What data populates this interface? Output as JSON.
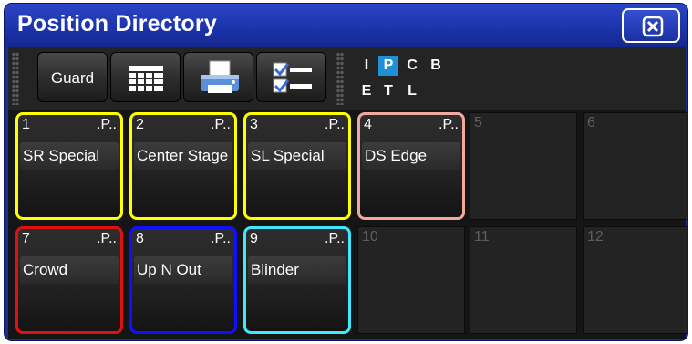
{
  "window": {
    "title": "Position Directory"
  },
  "toolbar": {
    "guard_label": "Guard",
    "buttons": [
      {
        "label": "Guard",
        "icon": "guard"
      },
      {
        "icon": "grid-view-icon"
      },
      {
        "icon": "printer-icon"
      },
      {
        "icon": "checklist-icon"
      }
    ],
    "filters": [
      "I",
      "P",
      "C",
      "B",
      "E",
      "T",
      "L"
    ],
    "active_filter": "P"
  },
  "colors": {
    "title_bar": "#1c34ad",
    "active_filter": "#1f8fd6",
    "yellow": "#ffff00",
    "pink": "#f0a8a0",
    "red": "#e01010",
    "blue": "#1010ff",
    "cyan": "#40e8ff"
  },
  "cells": [
    {
      "number": "1",
      "flag": ".P..",
      "name": "SR Special",
      "border": "#ffff00"
    },
    {
      "number": "2",
      "flag": ".P..",
      "name": "Center Stage",
      "border": "#ffff00"
    },
    {
      "number": "3",
      "flag": ".P..",
      "name": "SL Special",
      "border": "#ffff00"
    },
    {
      "number": "4",
      "flag": ".P..",
      "name": "DS Edge",
      "border": "#f0a8a0"
    },
    {
      "number": "5",
      "flag": "",
      "name": "",
      "border": ""
    },
    {
      "number": "6",
      "flag": "",
      "name": "",
      "border": ""
    },
    {
      "number": "7",
      "flag": ".P..",
      "name": "Crowd",
      "border": "#e01010"
    },
    {
      "number": "8",
      "flag": ".P..",
      "name": "Up N Out",
      "border": "#1010ff"
    },
    {
      "number": "9",
      "flag": ".P..",
      "name": "Blinder",
      "border": "#40e8ff"
    },
    {
      "number": "10",
      "flag": "",
      "name": "",
      "border": ""
    },
    {
      "number": "11",
      "flag": "",
      "name": "",
      "border": ""
    },
    {
      "number": "12",
      "flag": "",
      "name": "",
      "border": ""
    }
  ]
}
